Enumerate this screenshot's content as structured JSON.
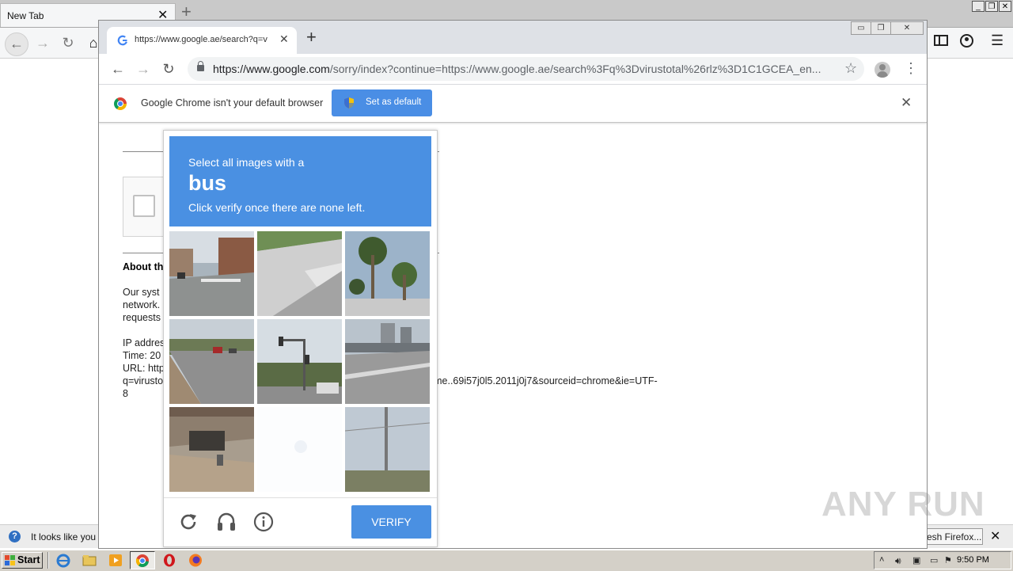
{
  "firefox": {
    "tab_title": "New Tab",
    "notification_text": "It looks like you h",
    "refresh_button": "esh Firefox..."
  },
  "chrome": {
    "tab_title": "https://www.google.ae/search?q=v",
    "url_host": "https://www.google.com",
    "url_path": "/sorry/index?continue=https://www.google.ae/search%3Fq%3Dvirustotal%26rlz%3D1C1GCEA_en...",
    "infobar_text": "Google Chrome isn't your default browser",
    "set_default_label": "Set as default"
  },
  "page": {
    "about_heading": "About th",
    "lines": [
      "Our syst",
      "network.",
      "requests"
    ],
    "ip_line": "IP addres",
    "time_line": "Time: 20",
    "url_line": "URL: http",
    "q_line_start": "q=virusto",
    "q_line_end": "rome..69i57j0l5.2011j0j7&sourceid=chrome&ie=UTF-",
    "last_line": "8"
  },
  "captcha": {
    "line1": "Select all images with a",
    "target": "bus",
    "line3": "Click verify once there are none left.",
    "verify_label": "VERIFY",
    "tiles": [
      "street-corner",
      "sidewalk-crosswalk",
      "palm-trees",
      "street-with-cars",
      "traffic-light-intersection",
      "highway-overpass",
      "underpass",
      "blank",
      "utility-pole"
    ]
  },
  "taskbar": {
    "start_label": "Start",
    "clock": "9:50 PM"
  },
  "watermark": "ANY RUN",
  "colors": {
    "captcha_blue": "#4a90e2",
    "set_default_blue": "#4a8ee5"
  }
}
